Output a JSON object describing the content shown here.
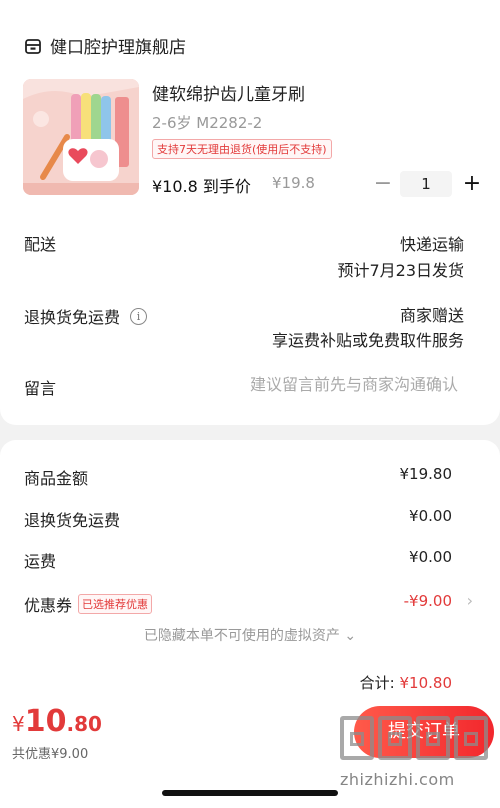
{
  "shop": {
    "name": "健口腔护理旗舰店",
    "icon": "store-icon"
  },
  "product": {
    "title": "健软绵护齿儿童牙刷",
    "spec": "2-6岁 M2282-2",
    "return_tag": "支持7天无理由退货(使用后不支持)",
    "final_price": "¥10.8 到手价",
    "original_price": "¥19.8",
    "quantity": "1",
    "minus_label": "−",
    "plus_label": "+"
  },
  "delivery": {
    "label": "配送",
    "method": "快递运输",
    "estimate": "预计7月23日发货"
  },
  "return_insurance": {
    "label": "退换货免运费",
    "value_line1": "商家赠送",
    "value_line2": "享运费补贴或免费取件服务"
  },
  "note": {
    "label": "留言",
    "placeholder": "建议留言前先与商家沟通确认"
  },
  "summary": {
    "rows": [
      {
        "label": "商品金额",
        "value": "¥19.80"
      },
      {
        "label": "退换货免运费",
        "value": "¥0.00"
      },
      {
        "label": "运费",
        "value": "¥0.00"
      }
    ],
    "coupon": {
      "label": "优惠券",
      "tag": "已选推荐优惠",
      "value": "-¥9.00"
    },
    "hidden_assets": "已隐藏本单不可使用的虚拟资产 ⌄",
    "total_label": "合计: ",
    "total_value": "¥10.80"
  },
  "checkout": {
    "currency": "¥",
    "price_int": "10",
    "price_dec": ".80",
    "saved": "共优惠¥9.00",
    "submit_label": "提交订单"
  },
  "watermark": {
    "text": "zhizhizhi.com"
  },
  "colors": {
    "accent": "#e23a3a",
    "submit_start": "#ff5a4a",
    "submit_end": "#f2272d"
  }
}
